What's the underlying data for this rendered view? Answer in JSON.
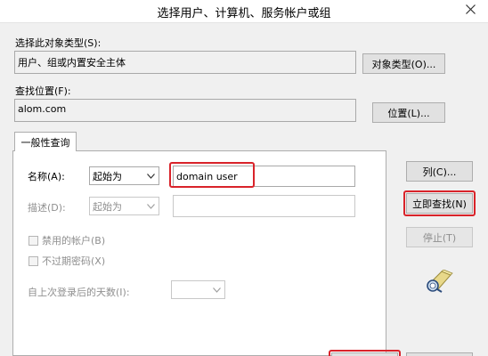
{
  "window": {
    "title": "选择用户、计算机、服务帐户或组",
    "close_label": "×"
  },
  "object_type": {
    "label": "选择此对象类型(S):",
    "value": "用户、组或内置安全主体",
    "button": "对象类型(O)..."
  },
  "location": {
    "label": "查找位置(F):",
    "value": "alom.com",
    "button": "位置(L)..."
  },
  "tab": {
    "label": "一般性查询"
  },
  "query": {
    "name_label": "名称(A):",
    "name_operator": "起始为",
    "name_value": "domain user",
    "desc_label": "描述(D):",
    "desc_operator": "起始为",
    "desc_value": "",
    "disabled_accounts": "禁用的帐户(B)",
    "non_expiring_pw": "不过期密码(X)",
    "days_label": "自上次登录后的天数(I):",
    "days_value": ""
  },
  "side_buttons": {
    "columns": "列(C)...",
    "find_now": "立即查找(N)",
    "stop": "停止(T)"
  },
  "colors": {
    "highlight": "#d9232a",
    "client_bg": "#f0f0f0"
  }
}
